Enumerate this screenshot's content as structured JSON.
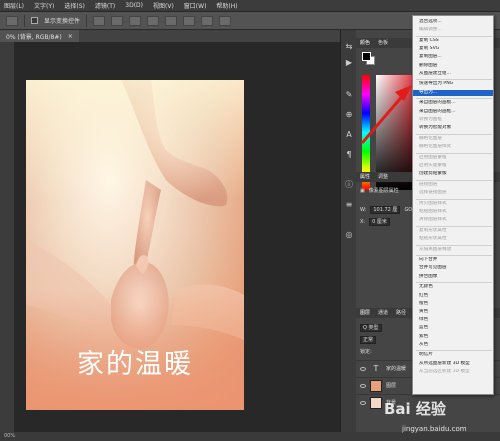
{
  "menu": [
    "图层(L)",
    "文字(Y)",
    "选择(S)",
    "滤镜(T)",
    "3D(D)",
    "视图(V)",
    "窗口(W)",
    "帮助(H)"
  ],
  "options": {
    "show_transform": "显示变换控件"
  },
  "document_tab": {
    "label": "0% (背景, RGB/8#)",
    "close": "×"
  },
  "document": {
    "title": "家的温暖"
  },
  "status": {
    "text": "00%"
  },
  "panels": {
    "color_tabs": [
      "颜色",
      "色板"
    ],
    "properties_tabs": [
      "属性",
      "调整"
    ],
    "properties_title": "像素图层属性",
    "w_label": "W:",
    "w_value": "101.72 厘",
    "go_label": "GO",
    "x_label": "X:",
    "x_value": "0 厘米",
    "layers_tabs": [
      "图层",
      "通道",
      "路径"
    ],
    "kind_filter": "Q 类型",
    "blend_mode": "正常",
    "lock_label": "锁定:",
    "layers": [
      {
        "name": "家的温暖",
        "type": "text"
      },
      {
        "name": "图层",
        "type": "pixel"
      },
      {
        "name": "背景",
        "type": "pixel"
      }
    ]
  },
  "context_menu": {
    "items": [
      {
        "label": "混合选项...",
        "state": "normal"
      },
      {
        "label": "编辑调整...",
        "state": "disabled"
      },
      {
        "label": "复制 CSS",
        "state": "normal"
      },
      {
        "label": "复制 SVG",
        "state": "normal"
      },
      {
        "label": "复制图层...",
        "state": "normal"
      },
      {
        "label": "删除图层",
        "state": "normal"
      },
      {
        "label": "从图层建立组...",
        "state": "normal"
      },
      {
        "label": "快速导出为 PNG",
        "state": "normal"
      },
      {
        "label": "导出为...",
        "state": "highlighted"
      },
      {
        "label": "来自图层的画板...",
        "state": "normal"
      },
      {
        "label": "来自图层的画框...",
        "state": "normal"
      },
      {
        "label": "转换为图框",
        "state": "disabled"
      },
      {
        "label": "转换为智能对象",
        "state": "normal"
      },
      {
        "label": "栅格化图层",
        "state": "disabled"
      },
      {
        "label": "栅格化图层样式",
        "state": "disabled"
      },
      {
        "label": "启用图层蒙版",
        "state": "disabled"
      },
      {
        "label": "启用矢量蒙版",
        "state": "disabled"
      },
      {
        "label": "创建剪贴蒙版",
        "state": "normal"
      },
      {
        "label": "链接图层",
        "state": "disabled"
      },
      {
        "label": "选择链接图层",
        "state": "disabled"
      },
      {
        "label": "拷贝图层样式",
        "state": "disabled"
      },
      {
        "label": "粘贴图层样式",
        "state": "disabled"
      },
      {
        "label": "清除图层样式",
        "state": "disabled"
      },
      {
        "label": "复制形状属性",
        "state": "disabled"
      },
      {
        "label": "粘贴形状属性",
        "state": "disabled"
      },
      {
        "label": "从隔离图层释放",
        "state": "disabled"
      },
      {
        "label": "向下合并",
        "state": "normal"
      },
      {
        "label": "合并可见图层",
        "state": "normal"
      },
      {
        "label": "拼合图像",
        "state": "normal"
      },
      {
        "label": "无颜色",
        "state": "normal"
      },
      {
        "label": "红色",
        "state": "normal"
      },
      {
        "label": "橙色",
        "state": "normal"
      },
      {
        "label": "黄色",
        "state": "normal"
      },
      {
        "label": "绿色",
        "state": "normal"
      },
      {
        "label": "蓝色",
        "state": "normal"
      },
      {
        "label": "紫色",
        "state": "normal"
      },
      {
        "label": "灰色",
        "state": "normal"
      },
      {
        "label": "明信片",
        "state": "normal"
      },
      {
        "label": "从所选图层新建 3D 模型",
        "state": "normal"
      },
      {
        "label": "从当前选区新建 3D 模型",
        "state": "disabled"
      }
    ]
  },
  "watermark": {
    "brand": "Bai 经验",
    "url": "jingyan.baidu.com"
  }
}
